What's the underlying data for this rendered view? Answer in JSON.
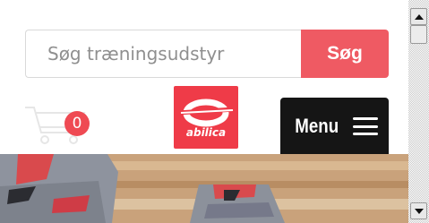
{
  "search": {
    "placeholder": "Søg træningsudstyr",
    "button_label": "Søg"
  },
  "cart": {
    "icon": "shopping-cart-icon",
    "count": "0"
  },
  "logo": {
    "text": "abilica",
    "color": "#ef3b48"
  },
  "menu": {
    "label": "Menu",
    "icon": "hamburger-icon"
  },
  "hero": {
    "description_icon": "sneakers-photo"
  },
  "colors": {
    "accent": "#ef5a63",
    "badge": "#ef4a53",
    "menu_bg": "#151515"
  }
}
